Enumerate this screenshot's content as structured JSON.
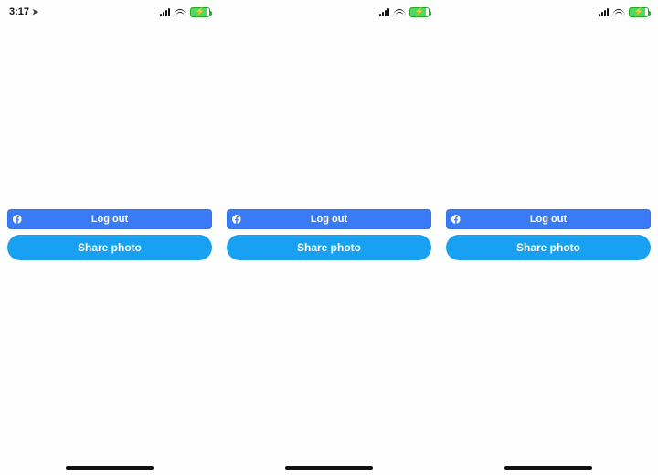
{
  "status": {
    "time": "3:17"
  },
  "buttons": {
    "logout_label": "Log out",
    "share_label": "Share photo"
  }
}
